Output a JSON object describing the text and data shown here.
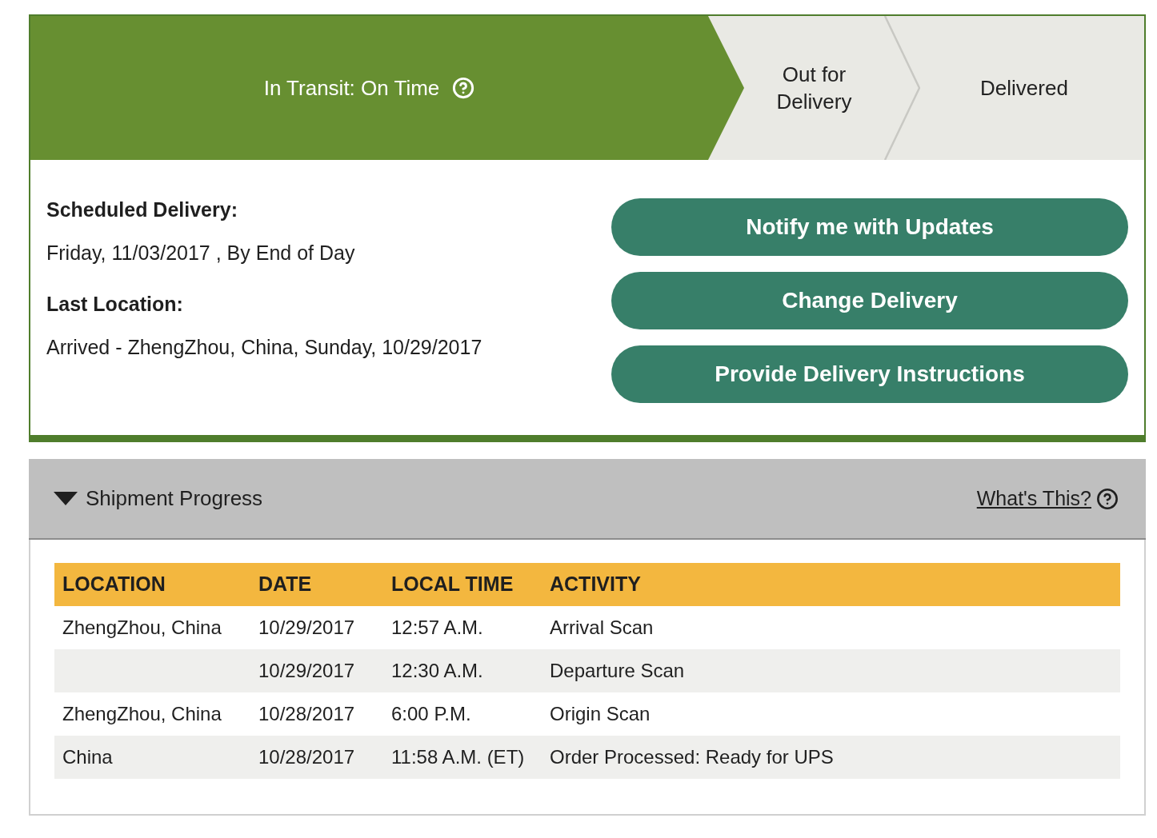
{
  "progress_steps": [
    {
      "label": "In Transit: On Time",
      "active": true
    },
    {
      "label": "Out for Delivery",
      "active": false
    },
    {
      "label": "Delivered",
      "active": false
    }
  ],
  "details": [
    {
      "label": "Scheduled Delivery:",
      "value": "Friday, 11/03/2017 , By End of Day"
    },
    {
      "label": "Last Location:",
      "value": "Arrived - ZhengZhou, China, Sunday, 10/29/2017"
    }
  ],
  "buttons": [
    "Notify me with Updates",
    "Change Delivery",
    "Provide Delivery Instructions"
  ],
  "shipment_progress": {
    "title": "Shipment Progress",
    "expanded": true,
    "help_link": "What's This?",
    "table": {
      "columns": [
        "LOCATION",
        "DATE",
        "LOCAL TIME",
        "ACTIVITY"
      ],
      "rows": [
        {
          "location": "ZhengZhou, China",
          "date": "10/29/2017",
          "local_time": "12:57 A.M.",
          "activity": "Arrival Scan"
        },
        {
          "date": "10/29/2017",
          "local_time": "12:30 A.M.",
          "activity": "Departure Scan"
        },
        {
          "location": "ZhengZhou, China",
          "date": "10/28/2017",
          "local_time": "6:00 P.M.",
          "activity": "Origin Scan"
        },
        {
          "location": "China",
          "date": "10/28/2017",
          "local_time": "11:58 A.M. (ET)",
          "activity": "Order Processed: Ready for UPS"
        }
      ]
    }
  }
}
